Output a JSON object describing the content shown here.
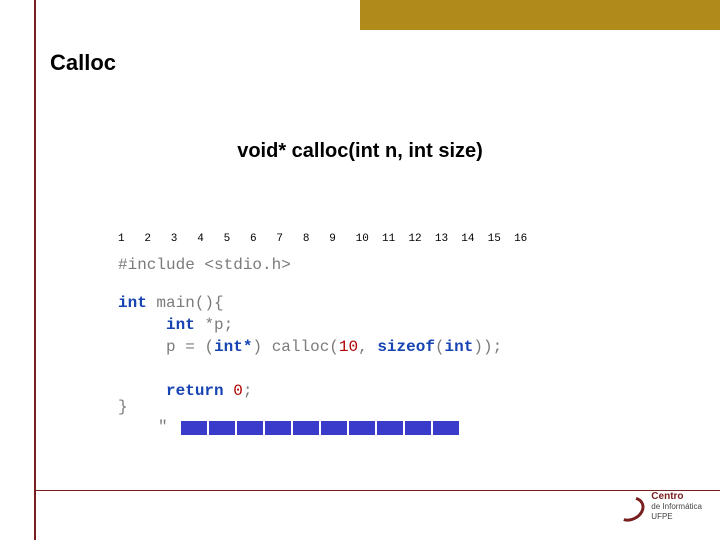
{
  "title": "Calloc",
  "subtitle": "void* calloc(int n, int size)",
  "ruler": "1   2   3   4   5   6   7   8   9   10  11  12  13  14  15  16",
  "code": {
    "include_directive": "#include",
    "include_header": "<stdio.h>",
    "kw_int": "int",
    "main_name": "main",
    "main_parens": "()",
    "brace_open": "{",
    "decl_star": "*",
    "decl_p": "p;",
    "assign_p": "p",
    "assign_eq": "=",
    "cast_open": "(",
    "cast_type": "int*",
    "cast_close": ")",
    "calloc_name": "calloc",
    "calloc_open": "(",
    "calloc_arg1": "10",
    "calloc_comma": ",",
    "sizeof_kw": "sizeof",
    "sizeof_open": "(",
    "sizeof_type": "int",
    "sizeof_close": ")",
    "calloc_close": ")",
    "stmt_semi": ";",
    "return_kw": "return",
    "return_val": "0",
    "return_semi": ";",
    "brace_close": "}"
  },
  "memory_cells": 10,
  "quote_mark": "\"",
  "logo": {
    "line1": "Centro",
    "line2": "de Informática",
    "line3": "UFPE"
  }
}
